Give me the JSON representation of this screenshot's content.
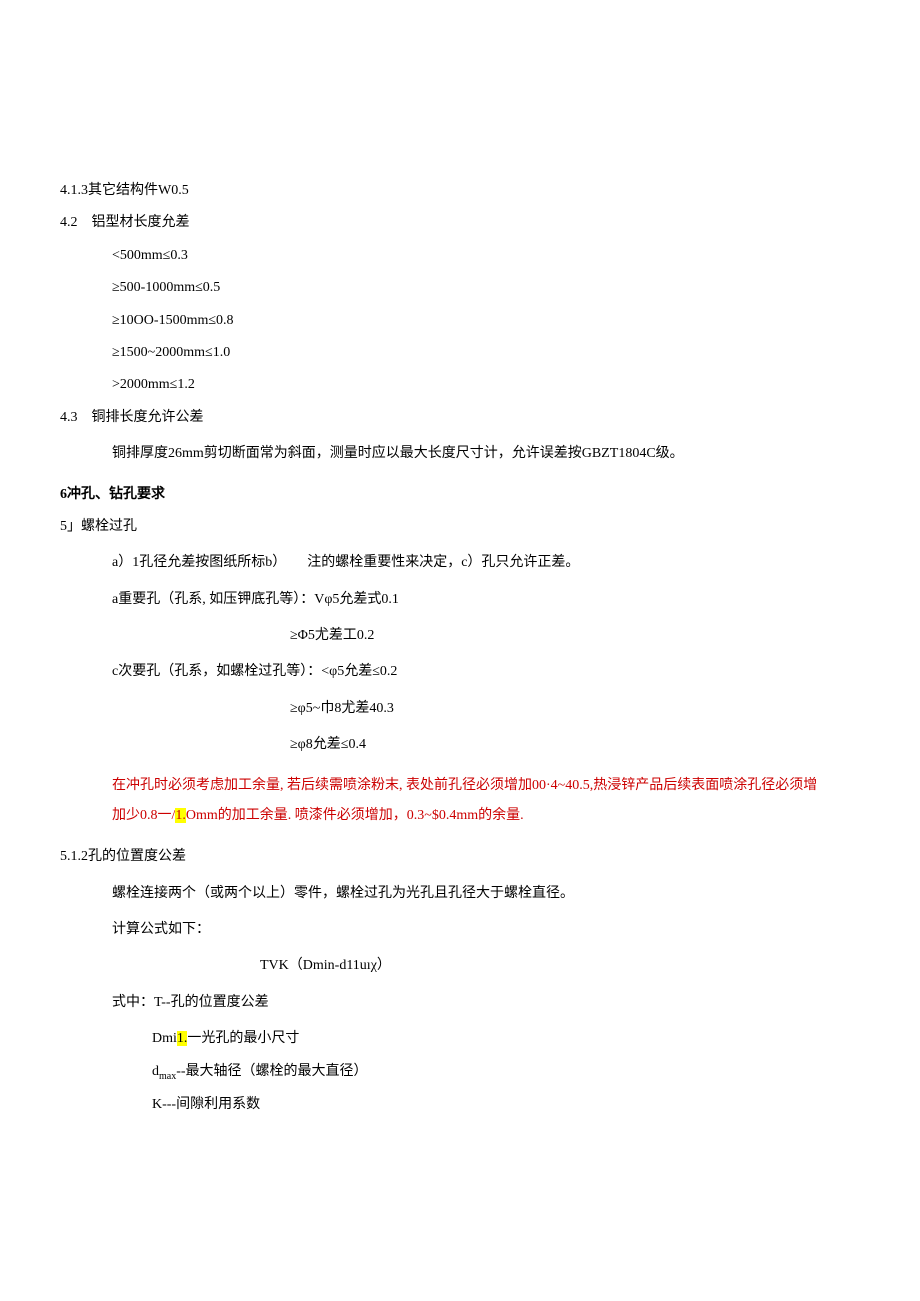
{
  "s413": "4.1.3其它结构件W0.5",
  "s42": {
    "title": "4.2　铝型材长度允差",
    "l1": "<500mm≤0.3",
    "l2": "≥500-1000mm≤0.5",
    "l3": "≥10OO-1500mm≤0.8",
    "l4": "≥1500~2000mm≤1.0",
    "l5": ">2000mm≤1.2"
  },
  "s43": {
    "title": "4.3　铜排长度允许公差",
    "body": "铜排厚度26mm剪切断面常为斜面，测量时应以最大长度尺寸计，允许误差按GBZT1804C级。"
  },
  "s5_head": "6冲孔、钻孔要求",
  "s51": {
    "title": "5」螺栓过孔",
    "a": "a）1孔径允差按图纸所标b）　　注的螺栓重要性来决定，c）孔只允许正差。",
    "major": "a重要孔（孔系, 如压钾底孔等）：Vφ5允差式0.1",
    "major2": "≥Φ5尤差工0.2",
    "minor": "c次要孔（孔系，如螺栓过孔等）：<φ5允差≤0.2",
    "minor2": "≥φ5~巾8尤差40.3",
    "minor3": "≥φ8允差≤0.4",
    "red1a": "在冲孔时必须考虑加工余量, 若后续需喷涂粉末, 表处前孔径必须增加00·4~40.5,热浸锌产品后续表面喷涂孔径必须增加少0.8一/",
    "red1_hl": "1.",
    "red1b": "Omm的加工余量. 喷漆件必须增加，0.3~$0.4mm的余量."
  },
  "s512": {
    "title": "5.1.2孔的位置度公差",
    "p1": "螺栓连接两个（或两个以上）零件，螺栓过孔为光孔且孔径大于螺栓直径。",
    "p2": "计算公式如下：",
    "formula": "TVK（Dmin-d11uıχ）",
    "def_intro": "式中：T--孔的位置度公差",
    "def_dmin_a": "Dmi",
    "def_dmin_hl": "1.",
    "def_dmin_b": "一光孔的最小尺寸",
    "def_dmax_a": "d",
    "def_dmax_sub": "max",
    "def_dmax_b": "--最大轴径（螺栓的最大直径）",
    "def_k": "K---间隙利用系数"
  }
}
